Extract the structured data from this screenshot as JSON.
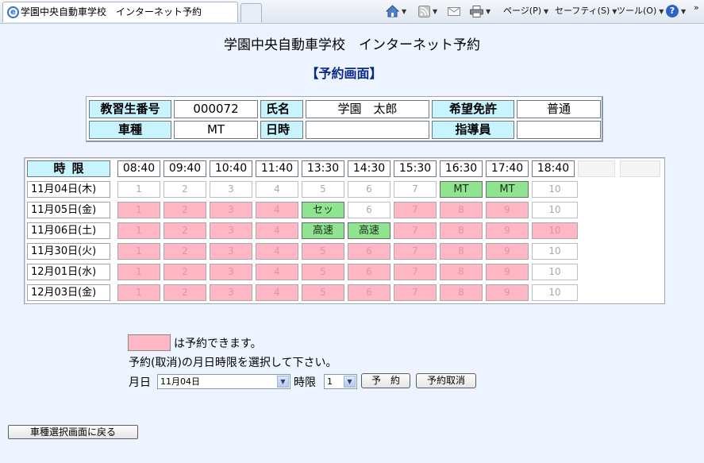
{
  "browser": {
    "tab_title": "学園中央自動車学校　インターネット予約",
    "toolbar": {
      "page": "ページ(P)",
      "safety": "セーフティ(S)",
      "tools": "ツール(O)",
      "help": "?"
    }
  },
  "page": {
    "title": "学園中央自動車学校　インターネット予約",
    "screen_title": "【予約画面】"
  },
  "info": {
    "student_no_label": "教習生番号",
    "student_no": "000072",
    "name_label": "氏名",
    "name": "学園　太郎",
    "license_label": "希望免許",
    "license": "普通",
    "vehicle_label": "車種",
    "vehicle": "MT",
    "datetime_label": "日時",
    "datetime": "",
    "instructor_label": "指導員",
    "instructor": ""
  },
  "schedule": {
    "period_label": "時限",
    "times": [
      "08:40",
      "09:40",
      "10:40",
      "11:40",
      "13:30",
      "14:30",
      "15:30",
      "16:30",
      "17:40",
      "18:40"
    ],
    "rows": [
      {
        "date": "11月04日(木)",
        "slots": [
          {
            "label": "1",
            "state": "white"
          },
          {
            "label": "2",
            "state": "white"
          },
          {
            "label": "3",
            "state": "white"
          },
          {
            "label": "4",
            "state": "white"
          },
          {
            "label": "5",
            "state": "white"
          },
          {
            "label": "6",
            "state": "white"
          },
          {
            "label": "7",
            "state": "white"
          },
          {
            "label": "MT",
            "state": "green"
          },
          {
            "label": "MT",
            "state": "green"
          },
          {
            "label": "10",
            "state": "white"
          }
        ]
      },
      {
        "date": "11月05日(金)",
        "slots": [
          {
            "label": "1",
            "state": "pink"
          },
          {
            "label": "2",
            "state": "pink"
          },
          {
            "label": "3",
            "state": "pink"
          },
          {
            "label": "4",
            "state": "pink"
          },
          {
            "label": "セッ",
            "state": "green"
          },
          {
            "label": "6",
            "state": "white"
          },
          {
            "label": "7",
            "state": "pink"
          },
          {
            "label": "8",
            "state": "pink"
          },
          {
            "label": "9",
            "state": "pink"
          },
          {
            "label": "10",
            "state": "white"
          }
        ]
      },
      {
        "date": "11月06日(土)",
        "slots": [
          {
            "label": "1",
            "state": "pink"
          },
          {
            "label": "2",
            "state": "pink"
          },
          {
            "label": "3",
            "state": "pink"
          },
          {
            "label": "4",
            "state": "pink"
          },
          {
            "label": "高速",
            "state": "green"
          },
          {
            "label": "高速",
            "state": "green"
          },
          {
            "label": "7",
            "state": "pink"
          },
          {
            "label": "8",
            "state": "pink"
          },
          {
            "label": "9",
            "state": "pink"
          },
          {
            "label": "10",
            "state": "pink"
          }
        ]
      },
      {
        "date": "11月30日(火)",
        "slots": [
          {
            "label": "1",
            "state": "pink"
          },
          {
            "label": "2",
            "state": "pink"
          },
          {
            "label": "3",
            "state": "pink"
          },
          {
            "label": "4",
            "state": "pink"
          },
          {
            "label": "5",
            "state": "pink"
          },
          {
            "label": "6",
            "state": "pink"
          },
          {
            "label": "7",
            "state": "pink"
          },
          {
            "label": "8",
            "state": "pink"
          },
          {
            "label": "9",
            "state": "pink"
          },
          {
            "label": "10",
            "state": "white"
          }
        ]
      },
      {
        "date": "12月01日(水)",
        "slots": [
          {
            "label": "1",
            "state": "pink"
          },
          {
            "label": "2",
            "state": "pink"
          },
          {
            "label": "3",
            "state": "pink"
          },
          {
            "label": "4",
            "state": "pink"
          },
          {
            "label": "5",
            "state": "pink"
          },
          {
            "label": "6",
            "state": "pink"
          },
          {
            "label": "7",
            "state": "pink"
          },
          {
            "label": "8",
            "state": "pink"
          },
          {
            "label": "9",
            "state": "pink"
          },
          {
            "label": "10",
            "state": "white"
          }
        ]
      },
      {
        "date": "12月03日(金)",
        "slots": [
          {
            "label": "1",
            "state": "pink"
          },
          {
            "label": "2",
            "state": "pink"
          },
          {
            "label": "3",
            "state": "pink"
          },
          {
            "label": "4",
            "state": "pink"
          },
          {
            "label": "5",
            "state": "pink"
          },
          {
            "label": "6",
            "state": "pink"
          },
          {
            "label": "7",
            "state": "pink"
          },
          {
            "label": "8",
            "state": "pink"
          },
          {
            "label": "9",
            "state": "pink"
          },
          {
            "label": "10",
            "state": "white"
          }
        ]
      }
    ]
  },
  "legend": {
    "text": "は予約できます。",
    "instruction": "予約(取消)の月日時限を選択して下さい。"
  },
  "form": {
    "date_label": "月日",
    "date_value": "11月04日",
    "period_label": "時限",
    "period_value": "1",
    "reserve_button": "予　約",
    "cancel_button": "予約取消"
  },
  "back_button": "車種選択画面に戻る",
  "colors": {
    "available": "#ffb6c5",
    "booked": "#8fe48f",
    "header_label": "#c8f4ff",
    "background": "#eef4ff"
  }
}
